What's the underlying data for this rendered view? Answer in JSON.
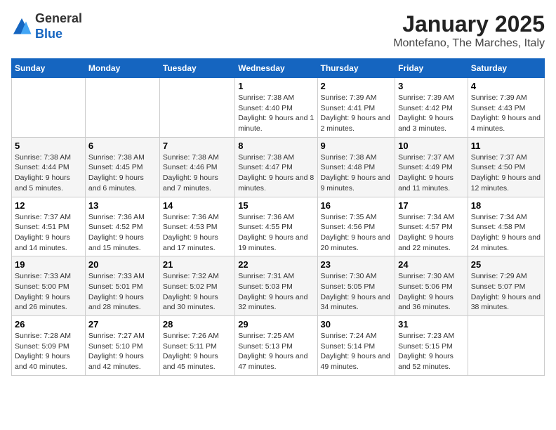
{
  "logo": {
    "general": "General",
    "blue": "Blue"
  },
  "title": "January 2025",
  "subtitle": "Montefano, The Marches, Italy",
  "days_header": [
    "Sunday",
    "Monday",
    "Tuesday",
    "Wednesday",
    "Thursday",
    "Friday",
    "Saturday"
  ],
  "weeks": [
    [
      {
        "num": "",
        "info": ""
      },
      {
        "num": "",
        "info": ""
      },
      {
        "num": "",
        "info": ""
      },
      {
        "num": "1",
        "info": "Sunrise: 7:38 AM\nSunset: 4:40 PM\nDaylight: 9 hours and 1 minute."
      },
      {
        "num": "2",
        "info": "Sunrise: 7:39 AM\nSunset: 4:41 PM\nDaylight: 9 hours and 2 minutes."
      },
      {
        "num": "3",
        "info": "Sunrise: 7:39 AM\nSunset: 4:42 PM\nDaylight: 9 hours and 3 minutes."
      },
      {
        "num": "4",
        "info": "Sunrise: 7:39 AM\nSunset: 4:43 PM\nDaylight: 9 hours and 4 minutes."
      }
    ],
    [
      {
        "num": "5",
        "info": "Sunrise: 7:38 AM\nSunset: 4:44 PM\nDaylight: 9 hours and 5 minutes."
      },
      {
        "num": "6",
        "info": "Sunrise: 7:38 AM\nSunset: 4:45 PM\nDaylight: 9 hours and 6 minutes."
      },
      {
        "num": "7",
        "info": "Sunrise: 7:38 AM\nSunset: 4:46 PM\nDaylight: 9 hours and 7 minutes."
      },
      {
        "num": "8",
        "info": "Sunrise: 7:38 AM\nSunset: 4:47 PM\nDaylight: 9 hours and 8 minutes."
      },
      {
        "num": "9",
        "info": "Sunrise: 7:38 AM\nSunset: 4:48 PM\nDaylight: 9 hours and 9 minutes."
      },
      {
        "num": "10",
        "info": "Sunrise: 7:37 AM\nSunset: 4:49 PM\nDaylight: 9 hours and 11 minutes."
      },
      {
        "num": "11",
        "info": "Sunrise: 7:37 AM\nSunset: 4:50 PM\nDaylight: 9 hours and 12 minutes."
      }
    ],
    [
      {
        "num": "12",
        "info": "Sunrise: 7:37 AM\nSunset: 4:51 PM\nDaylight: 9 hours and 14 minutes."
      },
      {
        "num": "13",
        "info": "Sunrise: 7:36 AM\nSunset: 4:52 PM\nDaylight: 9 hours and 15 minutes."
      },
      {
        "num": "14",
        "info": "Sunrise: 7:36 AM\nSunset: 4:53 PM\nDaylight: 9 hours and 17 minutes."
      },
      {
        "num": "15",
        "info": "Sunrise: 7:36 AM\nSunset: 4:55 PM\nDaylight: 9 hours and 19 minutes."
      },
      {
        "num": "16",
        "info": "Sunrise: 7:35 AM\nSunset: 4:56 PM\nDaylight: 9 hours and 20 minutes."
      },
      {
        "num": "17",
        "info": "Sunrise: 7:34 AM\nSunset: 4:57 PM\nDaylight: 9 hours and 22 minutes."
      },
      {
        "num": "18",
        "info": "Sunrise: 7:34 AM\nSunset: 4:58 PM\nDaylight: 9 hours and 24 minutes."
      }
    ],
    [
      {
        "num": "19",
        "info": "Sunrise: 7:33 AM\nSunset: 5:00 PM\nDaylight: 9 hours and 26 minutes."
      },
      {
        "num": "20",
        "info": "Sunrise: 7:33 AM\nSunset: 5:01 PM\nDaylight: 9 hours and 28 minutes."
      },
      {
        "num": "21",
        "info": "Sunrise: 7:32 AM\nSunset: 5:02 PM\nDaylight: 9 hours and 30 minutes."
      },
      {
        "num": "22",
        "info": "Sunrise: 7:31 AM\nSunset: 5:03 PM\nDaylight: 9 hours and 32 minutes."
      },
      {
        "num": "23",
        "info": "Sunrise: 7:30 AM\nSunset: 5:05 PM\nDaylight: 9 hours and 34 minutes."
      },
      {
        "num": "24",
        "info": "Sunrise: 7:30 AM\nSunset: 5:06 PM\nDaylight: 9 hours and 36 minutes."
      },
      {
        "num": "25",
        "info": "Sunrise: 7:29 AM\nSunset: 5:07 PM\nDaylight: 9 hours and 38 minutes."
      }
    ],
    [
      {
        "num": "26",
        "info": "Sunrise: 7:28 AM\nSunset: 5:09 PM\nDaylight: 9 hours and 40 minutes."
      },
      {
        "num": "27",
        "info": "Sunrise: 7:27 AM\nSunset: 5:10 PM\nDaylight: 9 hours and 42 minutes."
      },
      {
        "num": "28",
        "info": "Sunrise: 7:26 AM\nSunset: 5:11 PM\nDaylight: 9 hours and 45 minutes."
      },
      {
        "num": "29",
        "info": "Sunrise: 7:25 AM\nSunset: 5:13 PM\nDaylight: 9 hours and 47 minutes."
      },
      {
        "num": "30",
        "info": "Sunrise: 7:24 AM\nSunset: 5:14 PM\nDaylight: 9 hours and 49 minutes."
      },
      {
        "num": "31",
        "info": "Sunrise: 7:23 AM\nSunset: 5:15 PM\nDaylight: 9 hours and 52 minutes."
      },
      {
        "num": "",
        "info": ""
      }
    ]
  ]
}
